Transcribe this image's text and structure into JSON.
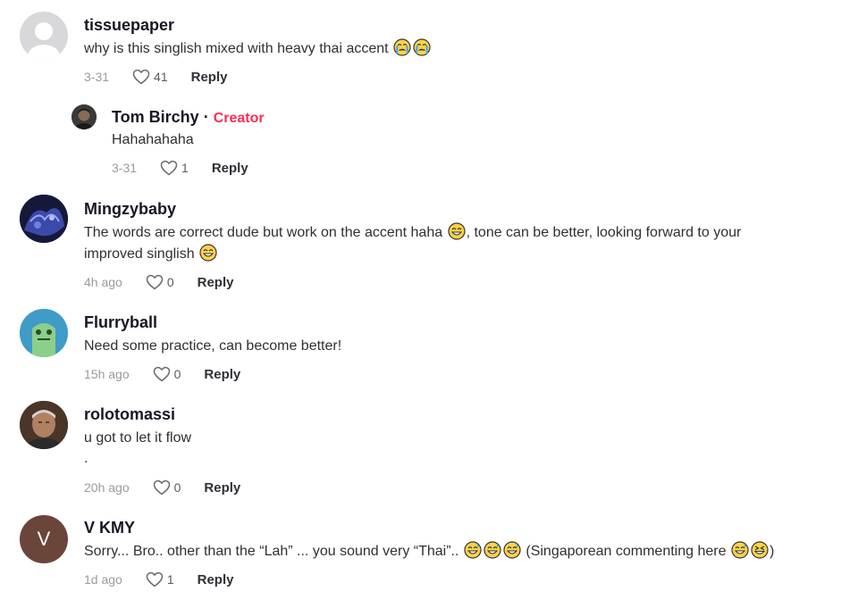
{
  "comments": [
    {
      "username": "tissuepaper",
      "text": "why is this singlish mixed with heavy thai accent",
      "emojis": [
        "crying-face",
        "crying-face"
      ],
      "time": "3-31",
      "likes": "41",
      "reply_label": "Reply",
      "avatar": "default-gray"
    },
    {
      "username": "Tom Birchy",
      "separator": "·",
      "badge": "Creator",
      "text": "Hahahahaha",
      "time": "3-31",
      "likes": "1",
      "reply_label": "Reply",
      "avatar": "photo-dark"
    },
    {
      "username": "Mingzybaby",
      "text_part1": "The words are correct dude but work on the accent haha",
      "text_part2": ", tone can be better, looking forward to your",
      "text_part3": "improved singlish",
      "time": "4h ago",
      "likes": "0",
      "reply_label": "Reply",
      "avatar": "photo-blue"
    },
    {
      "username": "Flurryball",
      "text": "Need some practice, can become better!",
      "time": "15h ago",
      "likes": "0",
      "reply_label": "Reply",
      "avatar": "green-creature"
    },
    {
      "username": "rolotomassi",
      "text": "u got to let it flow",
      "text_line2": ".",
      "time": "20h ago",
      "likes": "0",
      "reply_label": "Reply",
      "avatar": "photo-man"
    },
    {
      "username": "V KMY",
      "avatar_letter": "V",
      "text_part1": "Sorry... Bro.. other than the “Lah” ... you sound very “Thai”..",
      "text_part2": "(Singaporean commenting here",
      "text_part3": ")",
      "time": "1d ago",
      "likes": "1",
      "reply_label": "Reply",
      "avatar": "letter-brown"
    }
  ],
  "colors": {
    "creator_badge": "#fe2c55",
    "meta_gray": "#9a9aa0",
    "username": "#161823"
  }
}
